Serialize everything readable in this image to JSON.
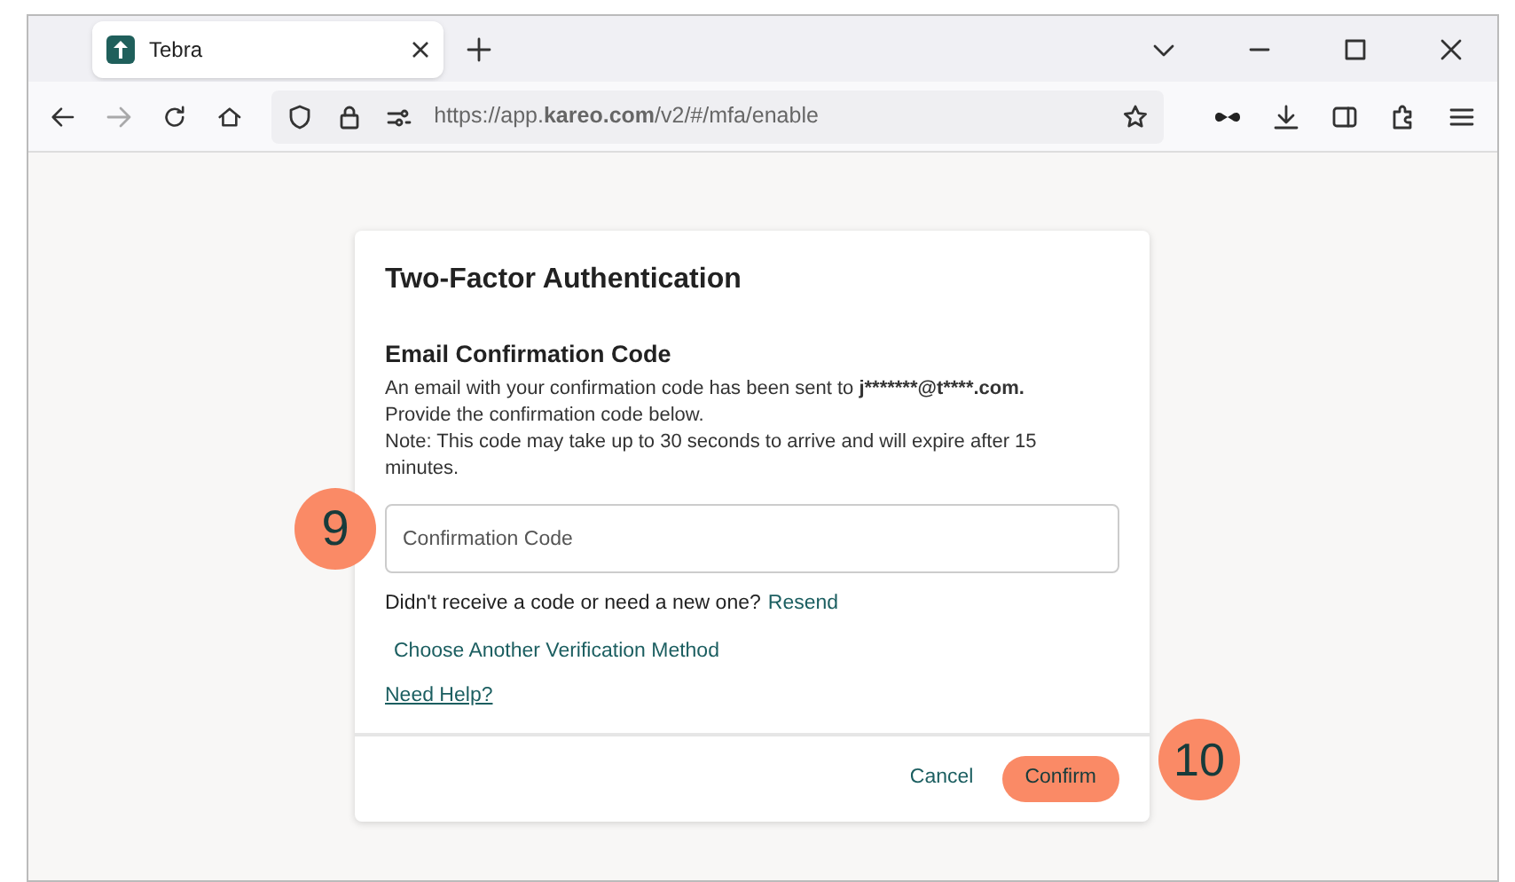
{
  "browser": {
    "tabs": [
      {
        "title": "Tebra",
        "selected": true
      }
    ],
    "url": "https://app.**kareo.com**/v2/#/mfa/enable"
  },
  "dialog": {
    "title": "Two-Factor Authentication",
    "section_title": "Email Confirmation Code",
    "sent_notice": {
      "text": "An email with your confirmation code has been sent to",
      "email": "j*******@t****.com."
    },
    "paragraphs": [
      "Provide the confirmation code below.",
      "Note: This code may take up to 30 seconds to arrive and will expire after 15 minutes."
    ],
    "code_field": {
      "placeholder": "Confirmation Code"
    },
    "resend_prompt": "Didn't receive a code or need a new one?",
    "resend_link": "Resend",
    "choose_method_link": "Choose Another Verification Method",
    "help_link": "Need Help?",
    "buttons": [
      {
        "label": "Cancel",
        "kind": "link"
      },
      {
        "label": "Confirm",
        "kind": "primary"
      }
    ]
  },
  "callouts": [
    {
      "number": "9"
    },
    {
      "number": "10"
    }
  ]
}
